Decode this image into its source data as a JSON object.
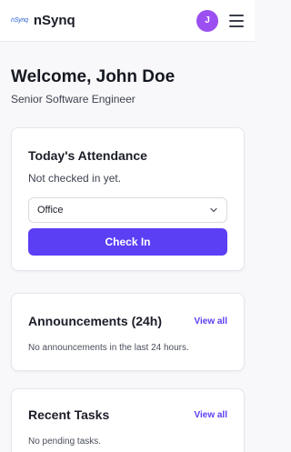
{
  "header": {
    "logo_text": "nSynq",
    "brand": "nSynq",
    "avatar_initial": "J",
    "avatar_color": "#9b4ff0"
  },
  "welcome": {
    "title": "Welcome, John Doe",
    "role": "Senior Software Engineer"
  },
  "attendance": {
    "title": "Today's Attendance",
    "status": "Not checked in yet.",
    "location_selected": "Office",
    "check_in_label": "Check In"
  },
  "announcements": {
    "title": "Announcements (24h)",
    "view_all": "View all",
    "empty_text": "No announcements in the last 24 hours."
  },
  "tasks": {
    "title": "Recent Tasks",
    "view_all": "View all",
    "empty_text": "No pending tasks."
  },
  "colors": {
    "accent": "#5b3ff5",
    "logo": "#2b63d8"
  },
  "icons": {
    "menu": "hamburger-menu-icon",
    "select": "chevron-down-icon"
  }
}
